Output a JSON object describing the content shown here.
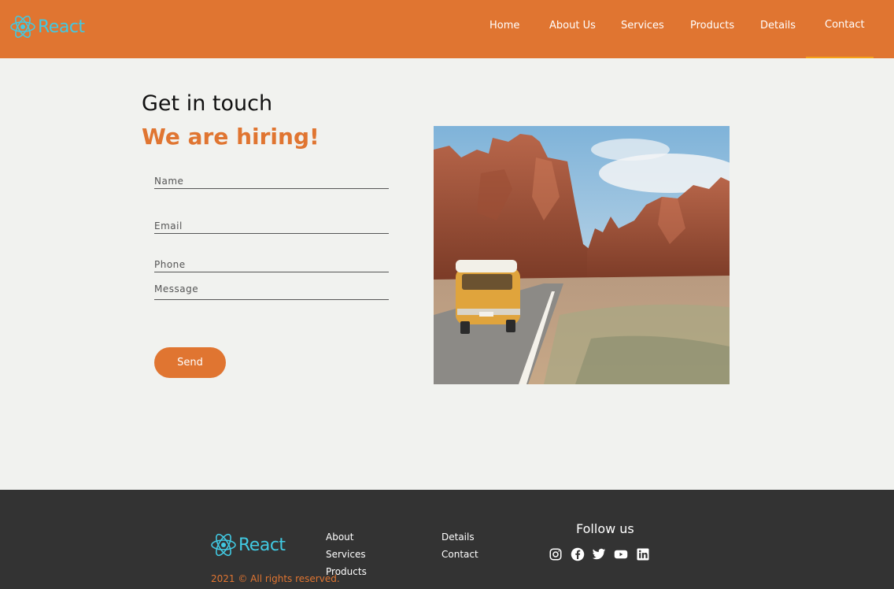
{
  "header": {
    "logo_text": "React",
    "logo_icon": "react-atom-icon",
    "nav": [
      {
        "label": "Home"
      },
      {
        "label": "About Us"
      },
      {
        "label": "Services"
      },
      {
        "label": "Products"
      },
      {
        "label": "Details"
      },
      {
        "label": "Contact"
      }
    ],
    "active": "Contact"
  },
  "main": {
    "title": "Get in touch",
    "subtitle": "We are hiring!",
    "form": {
      "name_placeholder": "Name",
      "email_placeholder": "Email",
      "phone_placeholder": "Phone",
      "message_placeholder": "Message",
      "send_label": "Send"
    }
  },
  "footer": {
    "logo_text": "React",
    "copyright": "2021 © All rights reserved.",
    "links_col1": [
      {
        "label": "About"
      },
      {
        "label": "Services"
      },
      {
        "label": "Products"
      }
    ],
    "links_col2": [
      {
        "label": "Details"
      },
      {
        "label": "Contact"
      }
    ],
    "follow_title": "Follow us",
    "social": [
      "instagram-icon",
      "facebook-icon",
      "twitter-icon",
      "youtube-icon",
      "linkedin-icon"
    ]
  },
  "colors": {
    "accent": "#e07531",
    "logo": "#41c9e2",
    "footer_bg": "#333333",
    "page_bg": "#f1f2ef",
    "active_underline": "#f6a21a"
  }
}
